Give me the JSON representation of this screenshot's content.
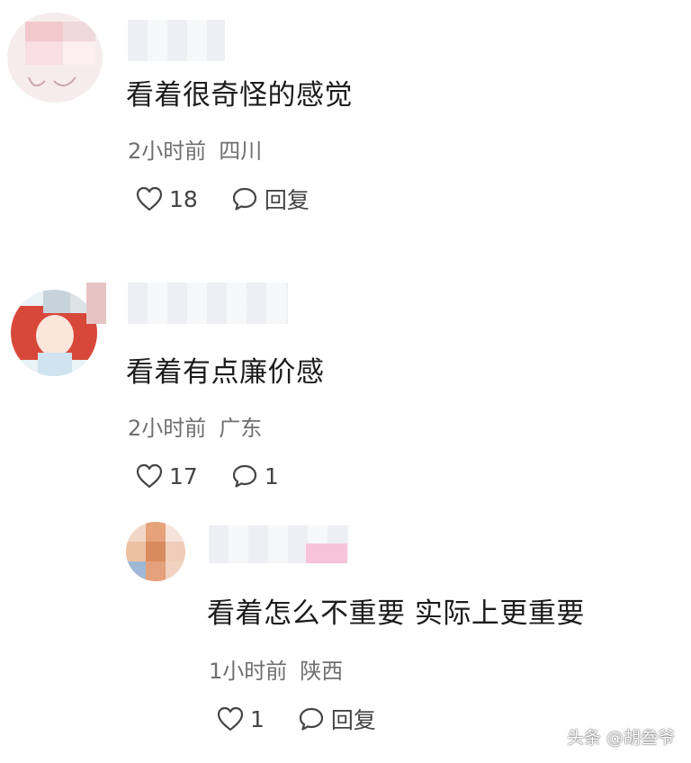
{
  "comments": [
    {
      "text": "看着很奇怪的感觉",
      "time": "2小时前",
      "location": "四川",
      "likes": "18",
      "reply_label": "回复"
    },
    {
      "text": "看着有点廉价感",
      "time": "2小时前",
      "location": "广东",
      "likes": "17",
      "reply_label": "1"
    },
    {
      "text": "看着怎么不重要 实际上更重要",
      "time": "1小时前",
      "location": "陕西",
      "likes": "1",
      "reply_label": "回复"
    }
  ],
  "watermark": "头条 @胡叁爷",
  "colors": {
    "text": "#1c1c1c",
    "meta": "#6f6f6f",
    "icon": "#444444",
    "background": "#ffffff"
  },
  "icons": [
    "heart-icon",
    "comment-bubble-icon",
    "avatar"
  ]
}
